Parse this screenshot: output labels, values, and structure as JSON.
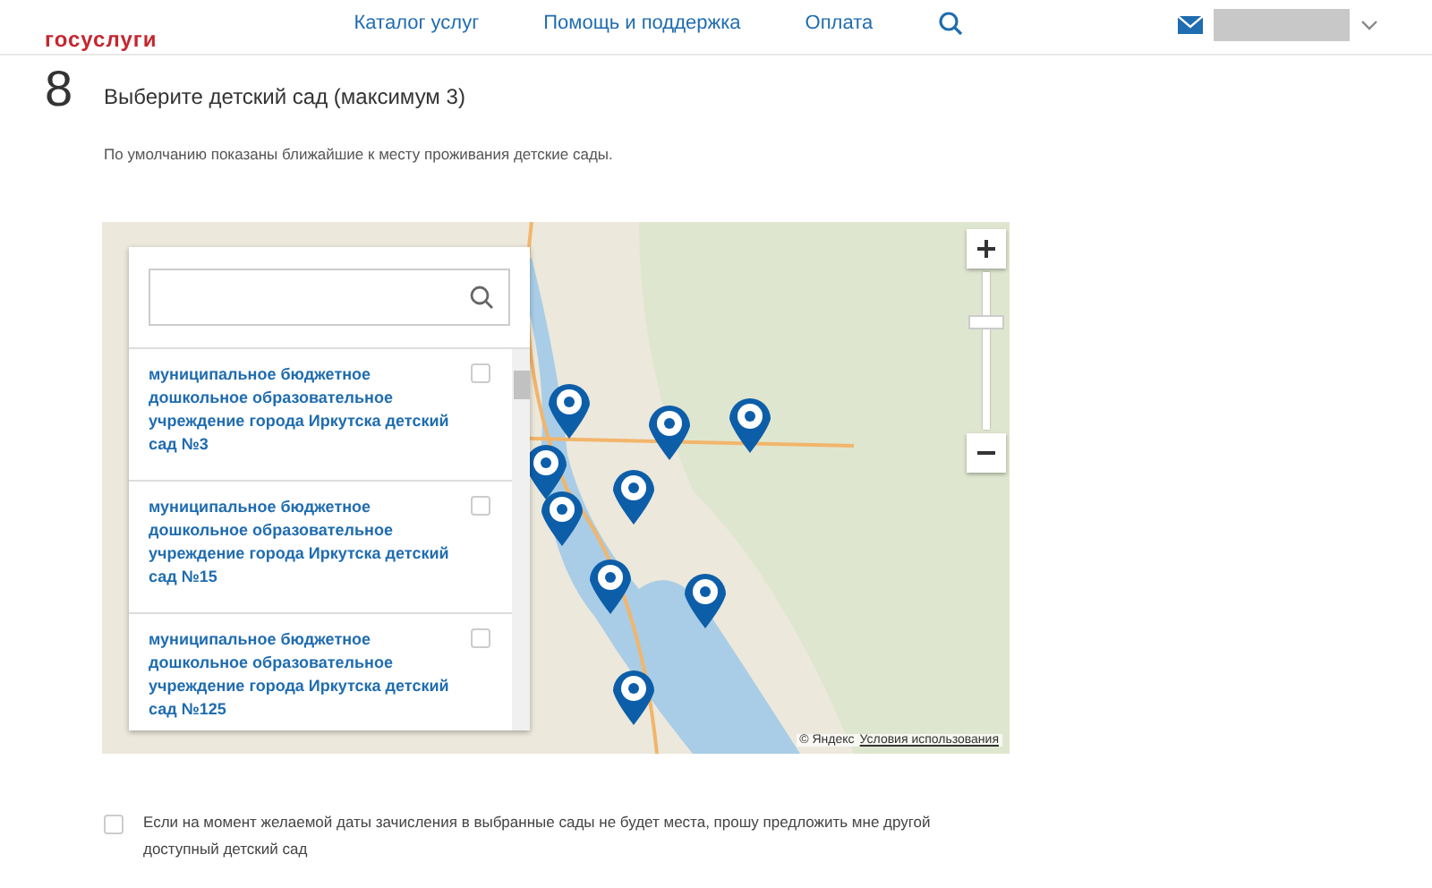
{
  "header": {
    "logo": "госуслуги",
    "nav": [
      "Каталог услуг",
      "Помощь и поддержка",
      "Оплата"
    ]
  },
  "step": {
    "number": "8",
    "title": "Выберите детский сад (максимум 3)",
    "description": "По умолчанию показаны ближайшие к месту проживания детские сады."
  },
  "map": {
    "zoom_slider": {
      "level": 0.7
    },
    "kindergartens": [
      {
        "name": "муниципальное бюджетное дошкольное образовательное учреждение города Иркутска детский сад №3",
        "checked": false
      },
      {
        "name": "муниципальное бюджетное дошкольное образовательное учреждение города Иркутска детский сад №15",
        "checked": false
      },
      {
        "name": "муниципальное бюджетное дошкольное образовательное учреждение города Иркутска детский сад №125",
        "checked": false
      }
    ],
    "attribution": "© Яндекс",
    "terms_link": "Условия использования"
  },
  "alternative": {
    "label": "Если на момент желаемой даты зачисления в выбранные сады не будет места, прошу предложить мне другой доступный детский сад",
    "checked": false
  }
}
